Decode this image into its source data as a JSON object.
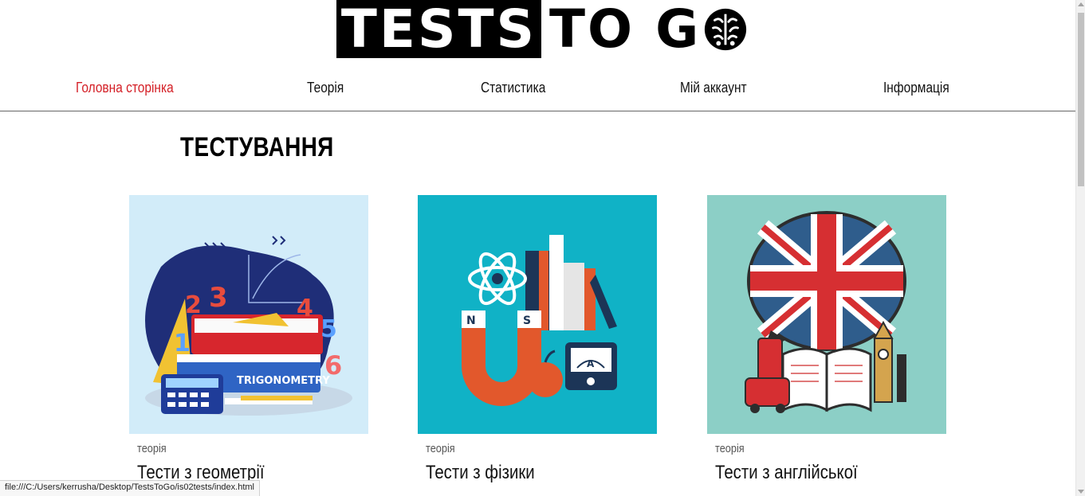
{
  "logo": {
    "part1": "TESTS",
    "part2": "TO G",
    "brain_icon": "brain-icon"
  },
  "nav": {
    "items": [
      {
        "label": "Головна сторінка",
        "active": true
      },
      {
        "label": "Теорія",
        "active": false
      },
      {
        "label": "Статистика",
        "active": false
      },
      {
        "label": "Мій аккаунт",
        "active": false
      },
      {
        "label": "Інформація",
        "active": false
      }
    ]
  },
  "main": {
    "section_title": "ТЕСТУВАННЯ",
    "cards": [
      {
        "tag": "теорія",
        "title": "Тести з геометрії",
        "image": "geometry-illustration",
        "bg": "#d2ecf9"
      },
      {
        "tag": "теорія",
        "title": "Тести з фізики",
        "image": "physics-illustration",
        "bg": "#10b2c6"
      },
      {
        "tag": "теорія",
        "title": "Тести з англійської",
        "image": "english-illustration",
        "bg": "#8ccfc6"
      }
    ]
  },
  "status_bar": {
    "url": "file:///C:/Users/kerrusha/Desktop/TestsToGo/is02tests/index.html"
  },
  "colors": {
    "accent": "#d41f26",
    "text": "#111111"
  }
}
